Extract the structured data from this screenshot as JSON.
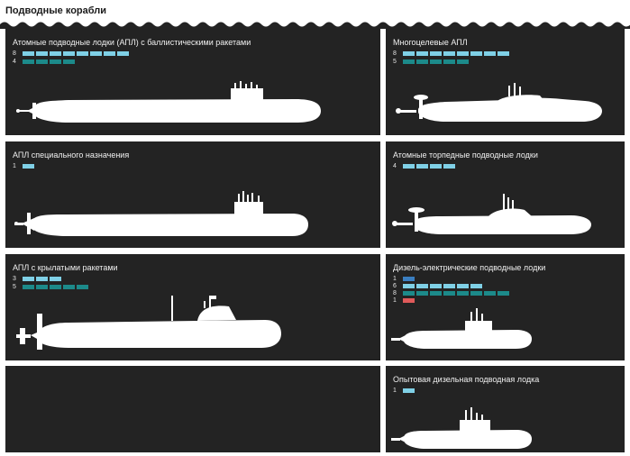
{
  "page_title": "Подводные корабли",
  "colors": {
    "panel_bg": "#232323",
    "silhouette": "#ffffff",
    "light_blue": "#7fd0e6",
    "teal": "#1c8a8a",
    "blue": "#3a7ec0",
    "red": "#e05a5a"
  },
  "panels": [
    {
      "title": "Атомные подводные лодки (АПЛ) с баллистическими ракетами",
      "rows": [
        {
          "count": "8",
          "blocks": 8,
          "color": "light_blue"
        },
        {
          "count": "4",
          "blocks": 4,
          "color": "teal"
        }
      ]
    },
    {
      "title": "Многоцелевые АПЛ",
      "rows": [
        {
          "count": "8",
          "blocks": 8,
          "color": "light_blue"
        },
        {
          "count": "5",
          "blocks": 5,
          "color": "teal"
        }
      ]
    },
    {
      "title": "АПЛ специального назначения",
      "rows": [
        {
          "count": "1",
          "blocks": 1,
          "color": "light_blue"
        }
      ]
    },
    {
      "title": "Атомные торпедные подводные лодки",
      "rows": [
        {
          "count": "4",
          "blocks": 4,
          "color": "light_blue"
        }
      ]
    },
    {
      "title": "АПЛ с крылатыми ракетами",
      "rows": [
        {
          "count": "3",
          "blocks": 3,
          "color": "light_blue"
        },
        {
          "count": "5",
          "blocks": 5,
          "color": "teal"
        }
      ]
    },
    {
      "title": "Дизель-электрические подводные лодки",
      "rows": [
        {
          "count": "1",
          "blocks": 1,
          "color": "blue"
        },
        {
          "count": "6",
          "blocks": 6,
          "color": "light_blue"
        },
        {
          "count": "8",
          "blocks": 8,
          "color": "teal"
        },
        {
          "count": "1",
          "blocks": 1,
          "color": "red"
        }
      ]
    },
    {
      "title": "",
      "rows": []
    },
    {
      "title": "Опытовая дизельная подводная лодка",
      "rows": [
        {
          "count": "1",
          "blocks": 1,
          "color": "light_blue"
        }
      ]
    }
  ]
}
